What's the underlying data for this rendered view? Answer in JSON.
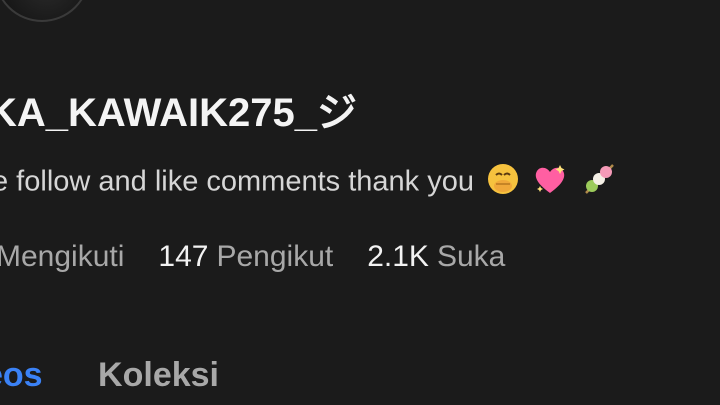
{
  "profile": {
    "username": "KA_KAWAIK275_ジ",
    "bio": "e follow and like comments thank you",
    "bio_emojis": [
      "hand-over-mouth-emoji",
      "sparkling-heart-emoji",
      "dango-emoji"
    ]
  },
  "stats": [
    {
      "value": "",
      "label": "Mengikuti"
    },
    {
      "value": "147",
      "label": "Pengikut"
    },
    {
      "value": "2.1K",
      "label": "Suka"
    }
  ],
  "tabs": [
    {
      "label": "eos",
      "active": true
    },
    {
      "label": "Koleksi",
      "active": false
    }
  ],
  "colors": {
    "background": "#1b1b1b",
    "active_tab": "#3b82f6",
    "secondary_text": "#a8a8a8"
  }
}
